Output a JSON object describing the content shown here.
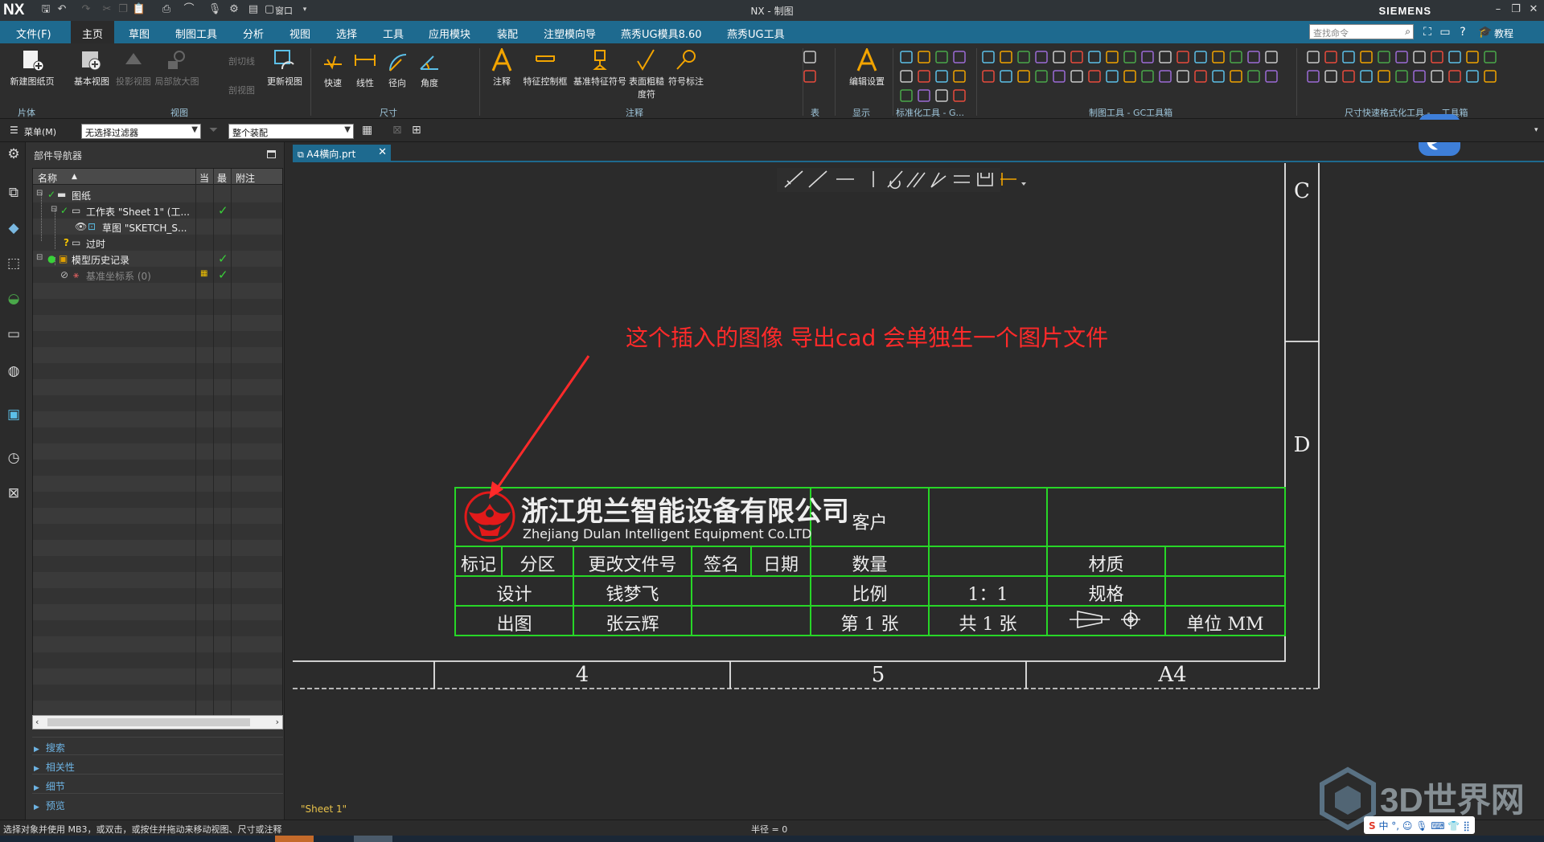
{
  "app": {
    "logo": "NX",
    "window_title": "NX - 制图",
    "brand": "SIEMENS",
    "window_menu": "窗口"
  },
  "menubar": {
    "items": [
      "文件(F)",
      "主页",
      "草图",
      "制图工具",
      "分析",
      "视图",
      "选择",
      "工具",
      "应用模块",
      "装配",
      "注塑模向导",
      "燕秀UG模具8.60",
      "燕秀UG工具"
    ],
    "active_index": 1,
    "search_placeholder": "查找命令",
    "help_label": "教程"
  },
  "ribbon": {
    "buttons": [
      {
        "label": "新建图纸页",
        "enabled": true
      },
      {
        "label": "基本视图",
        "enabled": true
      },
      {
        "label": "投影视图",
        "enabled": false
      },
      {
        "label": "局部放大图",
        "enabled": false
      },
      {
        "label": "剖切线",
        "enabled": false
      },
      {
        "label": "剖视图",
        "enabled": false
      },
      {
        "label": "更新视图",
        "enabled": true
      },
      {
        "label": "快速",
        "enabled": true
      },
      {
        "label": "线性",
        "enabled": true
      },
      {
        "label": "径向",
        "enabled": true
      },
      {
        "label": "角度",
        "enabled": true
      },
      {
        "label": "注释",
        "enabled": true
      },
      {
        "label": "特征控制框",
        "enabled": true
      },
      {
        "label": "基准特征符号",
        "enabled": true
      },
      {
        "label": "表面粗糙度符",
        "enabled": true
      },
      {
        "label": "符号标注",
        "enabled": true
      },
      {
        "label": "编辑设置",
        "enabled": true
      }
    ],
    "groups": [
      "片体",
      "视图",
      "尺寸",
      "注释",
      "表",
      "显示",
      "标准化工具 - G...",
      "制图工具 - GC工具箱",
      "尺寸快速格式化工具 - ...工具箱"
    ]
  },
  "filterbar": {
    "menu_label": "菜单(M)",
    "filter_value": "无选择过滤器",
    "assembly_value": "整个装配"
  },
  "navigator": {
    "title": "部件导航器",
    "columns": [
      "名称",
      "当",
      "最",
      "附注"
    ],
    "rows": [
      {
        "name": "图纸",
        "level": 0,
        "check": false
      },
      {
        "name": "工作表 \"Sheet 1\" (工...",
        "level": 1,
        "check": true
      },
      {
        "name": "草图 \"SKETCH_S...",
        "level": 2,
        "check": false
      },
      {
        "name": "过时",
        "level": 1,
        "check": false
      },
      {
        "name": "模型历史记录",
        "level": 0,
        "check": true
      },
      {
        "name": "基准坐标系 (0)",
        "level": 1,
        "check": true
      }
    ],
    "sections": [
      "搜索",
      "相关性",
      "细节",
      "预览"
    ]
  },
  "document": {
    "tab_label": "A4横向.prt",
    "sheet_label": "\"Sheet 1\""
  },
  "annotation": {
    "text": "这个插入的图像 导出cad 会单独生一个图片文件",
    "color": "#ff2a2a"
  },
  "title_block": {
    "company_cn": "浙江兜兰智能设备有限公司",
    "company_en": "Zhejiang Dulan Intelligent Equipment Co.LTD",
    "customer_label": "客户",
    "header_row": [
      "标记",
      "分区",
      "更改文件号",
      "签名",
      "日期"
    ],
    "quantity_label": "数量",
    "material_label": "材质",
    "design_label": "设计",
    "designer": "钱梦飞",
    "scale_label": "比例",
    "scale_value": "1：1",
    "spec_label": "规格",
    "drawing_label": "出图",
    "drafter": "张云辉",
    "sheet_no": "第 1 张",
    "sheet_total": "共 1 张",
    "unit": "单位 MM",
    "zones_bottom": [
      "4",
      "5",
      "A4"
    ],
    "zones_right": [
      "C",
      "D"
    ],
    "line_color": "#27d627"
  },
  "statusbar": {
    "message": "选择对象并使用 MB3，或双击，或按住并拖动来移动视图、尺寸或注释",
    "radius": "半径 = 0"
  },
  "watermark": {
    "text": "3D世界网"
  },
  "ime": {
    "text": "中 °, ☺ 🎙 ⌨ 👕 ⣿"
  }
}
